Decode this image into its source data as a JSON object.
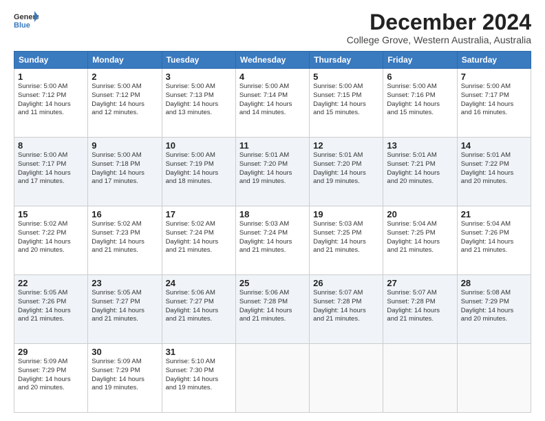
{
  "header": {
    "logo_line1": "General",
    "logo_line2": "Blue",
    "month_title": "December 2024",
    "location": "College Grove, Western Australia, Australia"
  },
  "days_of_week": [
    "Sunday",
    "Monday",
    "Tuesday",
    "Wednesday",
    "Thursday",
    "Friday",
    "Saturday"
  ],
  "weeks": [
    [
      {
        "day": "1",
        "info": "Sunrise: 5:00 AM\nSunset: 7:12 PM\nDaylight: 14 hours\nand 11 minutes."
      },
      {
        "day": "2",
        "info": "Sunrise: 5:00 AM\nSunset: 7:12 PM\nDaylight: 14 hours\nand 12 minutes."
      },
      {
        "day": "3",
        "info": "Sunrise: 5:00 AM\nSunset: 7:13 PM\nDaylight: 14 hours\nand 13 minutes."
      },
      {
        "day": "4",
        "info": "Sunrise: 5:00 AM\nSunset: 7:14 PM\nDaylight: 14 hours\nand 14 minutes."
      },
      {
        "day": "5",
        "info": "Sunrise: 5:00 AM\nSunset: 7:15 PM\nDaylight: 14 hours\nand 15 minutes."
      },
      {
        "day": "6",
        "info": "Sunrise: 5:00 AM\nSunset: 7:16 PM\nDaylight: 14 hours\nand 15 minutes."
      },
      {
        "day": "7",
        "info": "Sunrise: 5:00 AM\nSunset: 7:17 PM\nDaylight: 14 hours\nand 16 minutes."
      }
    ],
    [
      {
        "day": "8",
        "info": "Sunrise: 5:00 AM\nSunset: 7:17 PM\nDaylight: 14 hours\nand 17 minutes."
      },
      {
        "day": "9",
        "info": "Sunrise: 5:00 AM\nSunset: 7:18 PM\nDaylight: 14 hours\nand 17 minutes."
      },
      {
        "day": "10",
        "info": "Sunrise: 5:00 AM\nSunset: 7:19 PM\nDaylight: 14 hours\nand 18 minutes."
      },
      {
        "day": "11",
        "info": "Sunrise: 5:01 AM\nSunset: 7:20 PM\nDaylight: 14 hours\nand 19 minutes."
      },
      {
        "day": "12",
        "info": "Sunrise: 5:01 AM\nSunset: 7:20 PM\nDaylight: 14 hours\nand 19 minutes."
      },
      {
        "day": "13",
        "info": "Sunrise: 5:01 AM\nSunset: 7:21 PM\nDaylight: 14 hours\nand 20 minutes."
      },
      {
        "day": "14",
        "info": "Sunrise: 5:01 AM\nSunset: 7:22 PM\nDaylight: 14 hours\nand 20 minutes."
      }
    ],
    [
      {
        "day": "15",
        "info": "Sunrise: 5:02 AM\nSunset: 7:22 PM\nDaylight: 14 hours\nand 20 minutes."
      },
      {
        "day": "16",
        "info": "Sunrise: 5:02 AM\nSunset: 7:23 PM\nDaylight: 14 hours\nand 21 minutes."
      },
      {
        "day": "17",
        "info": "Sunrise: 5:02 AM\nSunset: 7:24 PM\nDaylight: 14 hours\nand 21 minutes."
      },
      {
        "day": "18",
        "info": "Sunrise: 5:03 AM\nSunset: 7:24 PM\nDaylight: 14 hours\nand 21 minutes."
      },
      {
        "day": "19",
        "info": "Sunrise: 5:03 AM\nSunset: 7:25 PM\nDaylight: 14 hours\nand 21 minutes."
      },
      {
        "day": "20",
        "info": "Sunrise: 5:04 AM\nSunset: 7:25 PM\nDaylight: 14 hours\nand 21 minutes."
      },
      {
        "day": "21",
        "info": "Sunrise: 5:04 AM\nSunset: 7:26 PM\nDaylight: 14 hours\nand 21 minutes."
      }
    ],
    [
      {
        "day": "22",
        "info": "Sunrise: 5:05 AM\nSunset: 7:26 PM\nDaylight: 14 hours\nand 21 minutes."
      },
      {
        "day": "23",
        "info": "Sunrise: 5:05 AM\nSunset: 7:27 PM\nDaylight: 14 hours\nand 21 minutes."
      },
      {
        "day": "24",
        "info": "Sunrise: 5:06 AM\nSunset: 7:27 PM\nDaylight: 14 hours\nand 21 minutes."
      },
      {
        "day": "25",
        "info": "Sunrise: 5:06 AM\nSunset: 7:28 PM\nDaylight: 14 hours\nand 21 minutes."
      },
      {
        "day": "26",
        "info": "Sunrise: 5:07 AM\nSunset: 7:28 PM\nDaylight: 14 hours\nand 21 minutes."
      },
      {
        "day": "27",
        "info": "Sunrise: 5:07 AM\nSunset: 7:28 PM\nDaylight: 14 hours\nand 21 minutes."
      },
      {
        "day": "28",
        "info": "Sunrise: 5:08 AM\nSunset: 7:29 PM\nDaylight: 14 hours\nand 20 minutes."
      }
    ],
    [
      {
        "day": "29",
        "info": "Sunrise: 5:09 AM\nSunset: 7:29 PM\nDaylight: 14 hours\nand 20 minutes."
      },
      {
        "day": "30",
        "info": "Sunrise: 5:09 AM\nSunset: 7:29 PM\nDaylight: 14 hours\nand 19 minutes."
      },
      {
        "day": "31",
        "info": "Sunrise: 5:10 AM\nSunset: 7:30 PM\nDaylight: 14 hours\nand 19 minutes."
      },
      null,
      null,
      null,
      null
    ]
  ]
}
